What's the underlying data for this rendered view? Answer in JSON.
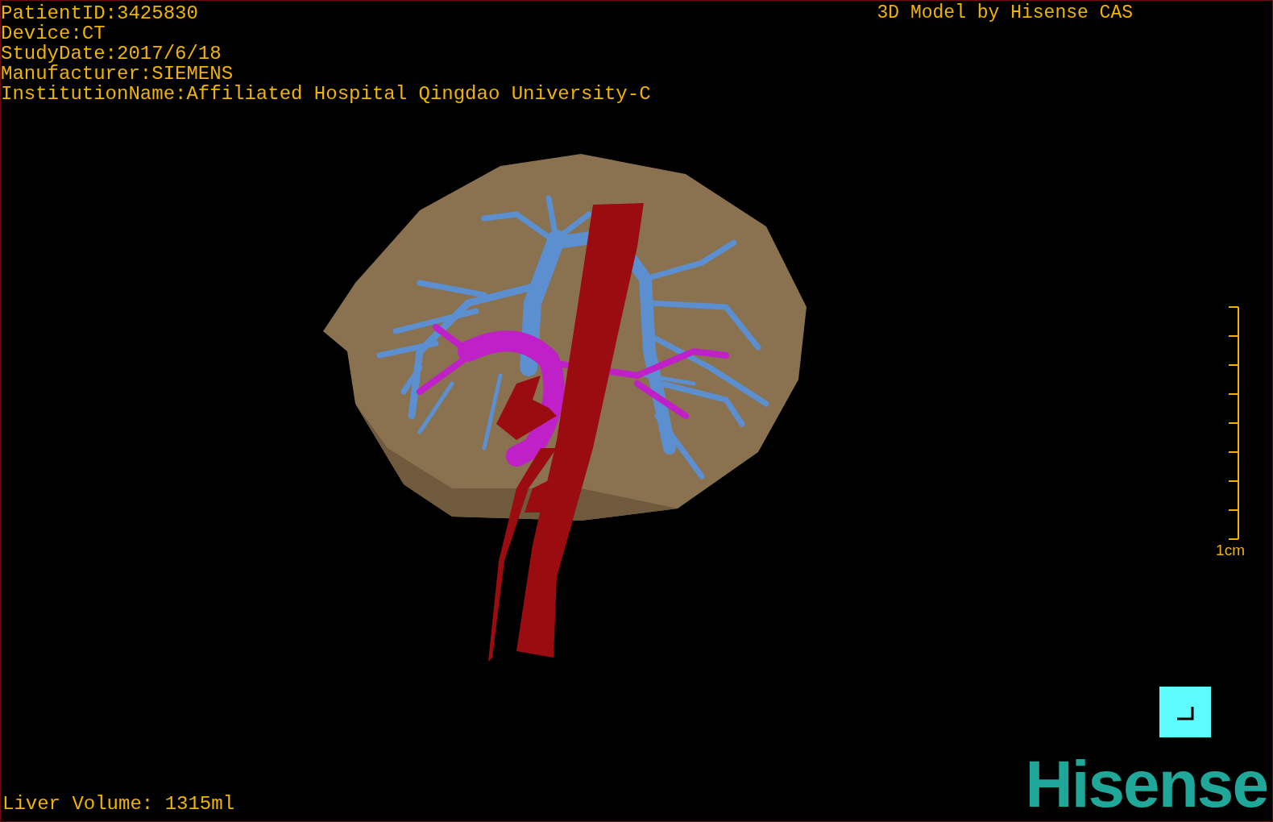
{
  "info": [
    "PatientID:3425830",
    "Device:CT",
    "StudyDate:2017/6/18",
    "Manufacturer:SIEMENS",
    "InstitutionName:Affiliated Hospital Qingdao University-C"
  ],
  "title": "3D Model by Hisense CAS",
  "scale_bar": {
    "label": "1cm"
  },
  "liver_volume": "Liver Volume: 1315ml",
  "logo": "Hisense"
}
